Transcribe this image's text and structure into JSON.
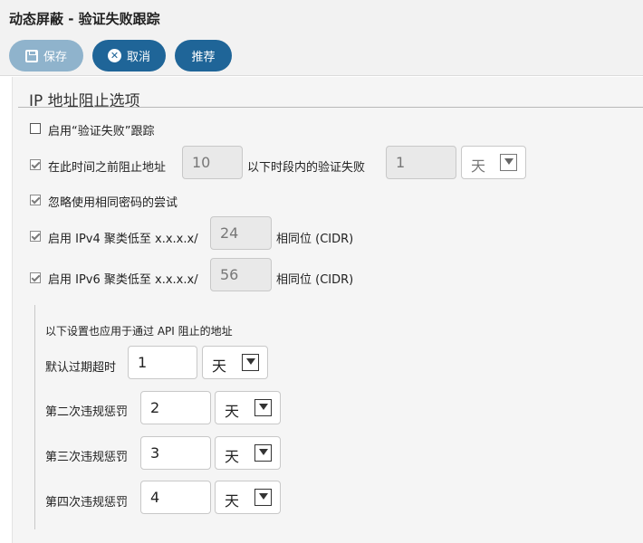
{
  "title": "动态屏蔽 - 验证失败跟踪",
  "toolbar": {
    "save_label": "保存",
    "cancel_label": "取消",
    "recommend_label": "推荐"
  },
  "section": {
    "title": "IP 地址阻止选项"
  },
  "options": {
    "enable_tracking": {
      "label": "启用“验证失败”跟踪",
      "checked": false
    },
    "block_before": {
      "label": "在此时间之前阻止地址",
      "value": "10",
      "middle_label": "以下时段内的验证失败",
      "count": "1",
      "unit": "天",
      "checked": true
    },
    "ignore_same_password": {
      "label": "忽略使用相同密码的尝试",
      "checked": true
    },
    "ipv4": {
      "label": "启用 IPv4 聚类低至 x.x.x.x/",
      "value": "24",
      "suffix": "相同位 (CIDR)",
      "checked": true
    },
    "ipv6": {
      "label": "启用 IPv6 聚类低至 x.x.x.x/",
      "value": "56",
      "suffix": "相同位 (CIDR)",
      "checked": true
    }
  },
  "api_settings": {
    "caption": "以下设置也应用于通过 API 阻止的地址",
    "default_expire": {
      "label": "默认过期超时",
      "value": "1",
      "unit": "天"
    },
    "second_penalty": {
      "label": "第二次违规惩罚",
      "value": "2",
      "unit": "天"
    },
    "third_penalty": {
      "label": "第三次违规惩罚",
      "value": "3",
      "unit": "天"
    },
    "fourth_penalty": {
      "label": "第四次违规惩罚",
      "value": "4",
      "unit": "天"
    }
  }
}
